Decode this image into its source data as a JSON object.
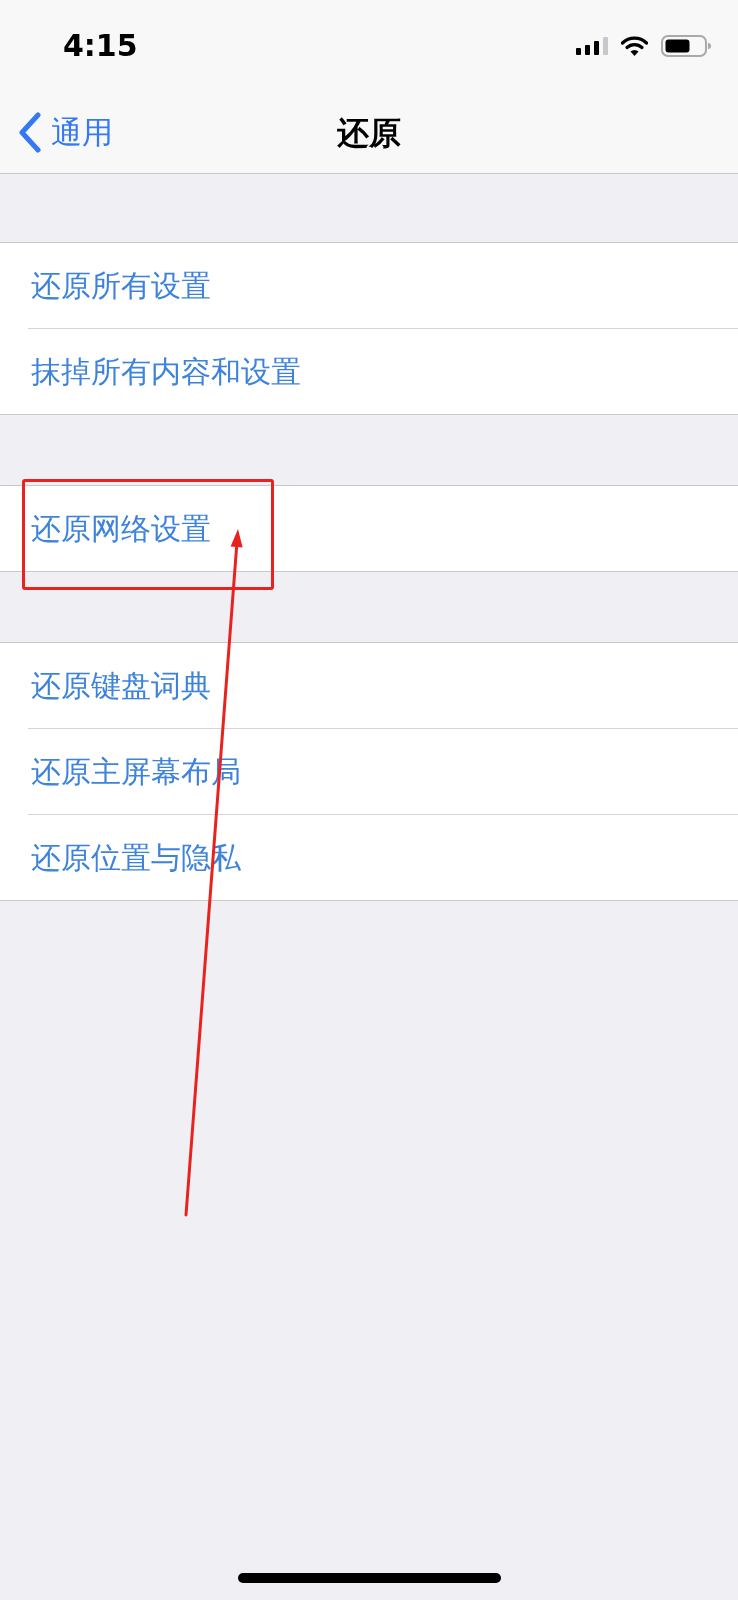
{
  "status_bar": {
    "time": "4:15"
  },
  "nav_bar": {
    "back_label": "通用",
    "title": "还原"
  },
  "groups": [
    {
      "items": [
        {
          "label": "还原所有设置",
          "annotated": false
        },
        {
          "label": "抹掉所有内容和设置",
          "annotated": false
        }
      ]
    },
    {
      "items": [
        {
          "label": "还原网络设置",
          "annotated": true
        }
      ]
    },
    {
      "items": [
        {
          "label": "还原键盘词典",
          "annotated": false
        },
        {
          "label": "还原主屏幕布局",
          "annotated": false
        },
        {
          "label": "还原位置与隐私",
          "annotated": false
        }
      ]
    }
  ]
}
